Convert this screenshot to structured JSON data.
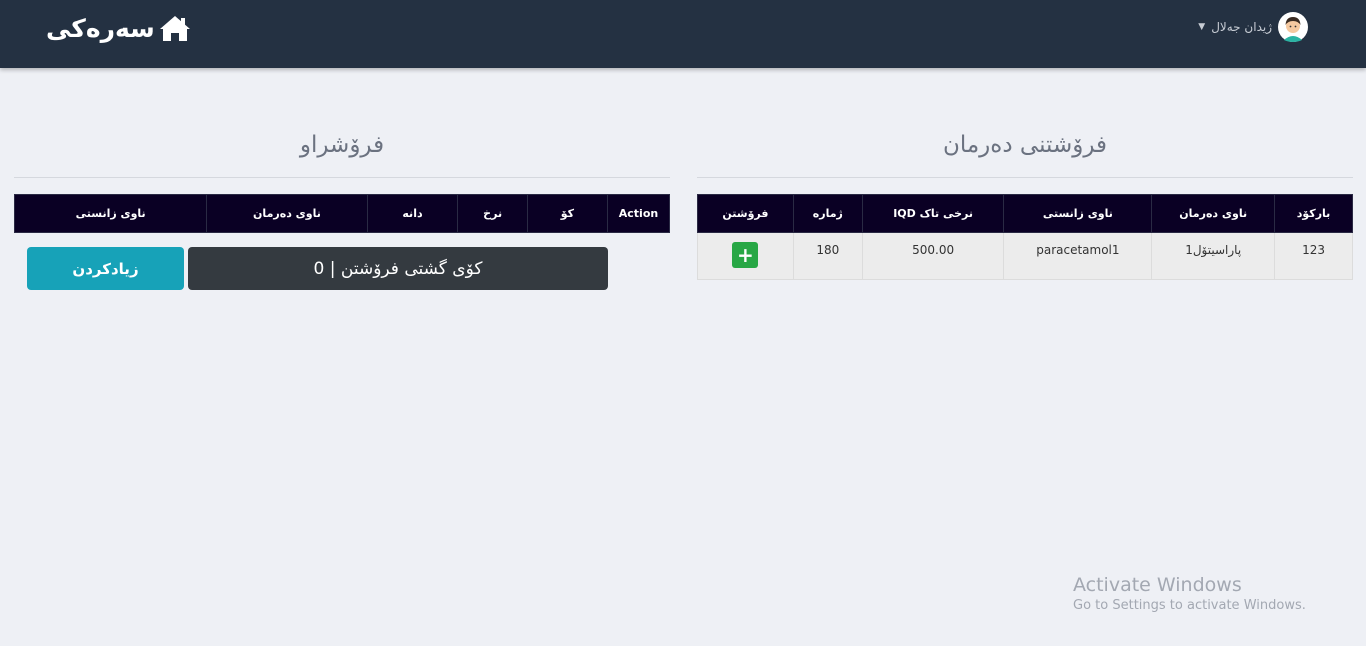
{
  "navbar": {
    "brand_label": "سەرەکی",
    "brand_icon": "home-icon",
    "user_name": "ژیدان جەلال",
    "user_icon": "avatar-icon"
  },
  "sold_panel": {
    "title": "فرۆشراو",
    "headers": [
      "ناوی زانستی",
      "ناوی دەرمان",
      "دانە",
      "نرخ",
      "کۆ",
      "Action"
    ],
    "total_label": "کۆی گشتی فرۆشتن | 0",
    "add_button": "زیادکردن"
  },
  "sell_panel": {
    "title": "فرۆشتنی دەرمان",
    "headers": [
      "بارکۆد",
      "ناوی دەرمان",
      "ناوی زانستی",
      "IQD نرخی تاک",
      "ژمارە",
      "فرۆشتن"
    ],
    "rows": [
      {
        "barcode": "123",
        "name": "پاراسیتۆل1",
        "scientific_name": "paracetamol1",
        "price": "500.00",
        "quantity": "180",
        "action": "+"
      }
    ]
  },
  "watermark": {
    "line1": "Activate Windows",
    "line2": "Go to Settings to activate Windows."
  },
  "colors": {
    "navbar": "#243142",
    "table_header": "#0a0024",
    "sell_button": "#28a745",
    "add_button": "#17a2b8",
    "total_box": "#343a40"
  }
}
